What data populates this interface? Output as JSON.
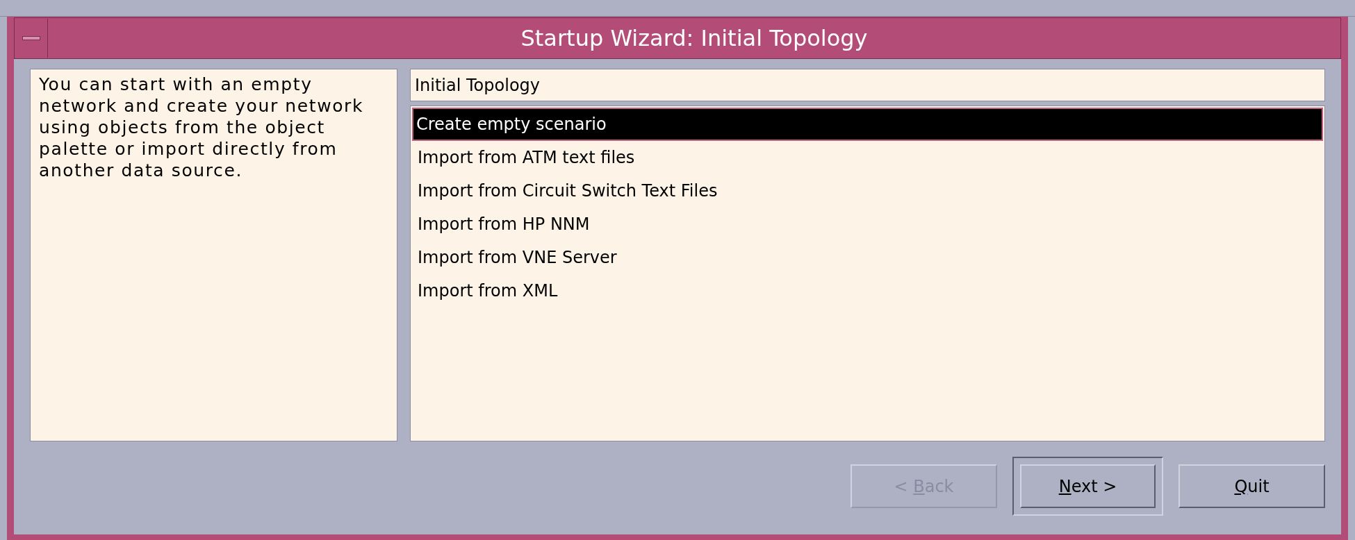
{
  "window": {
    "title": "Startup Wizard: Initial Topology"
  },
  "description": "You can start with an empty network and create your network using objects from the object palette or import directly from another data source.",
  "list": {
    "header": "Initial Topology",
    "items": [
      {
        "label": "Create empty scenario",
        "selected": true
      },
      {
        "label": "Import from ATM text files",
        "selected": false
      },
      {
        "label": "Import from Circuit Switch Text Files",
        "selected": false
      },
      {
        "label": "Import from HP NNM",
        "selected": false
      },
      {
        "label": "Import from VNE Server",
        "selected": false
      },
      {
        "label": "Import from XML",
        "selected": false
      }
    ]
  },
  "buttons": [
    {
      "pre": "< ",
      "key": "B",
      "post": "ack",
      "disabled": true,
      "default": false
    },
    {
      "key": "N",
      "post": "ext >",
      "disabled": false,
      "default": true
    },
    {
      "key": "Q",
      "post": "uit",
      "disabled": false,
      "default": false
    }
  ]
}
